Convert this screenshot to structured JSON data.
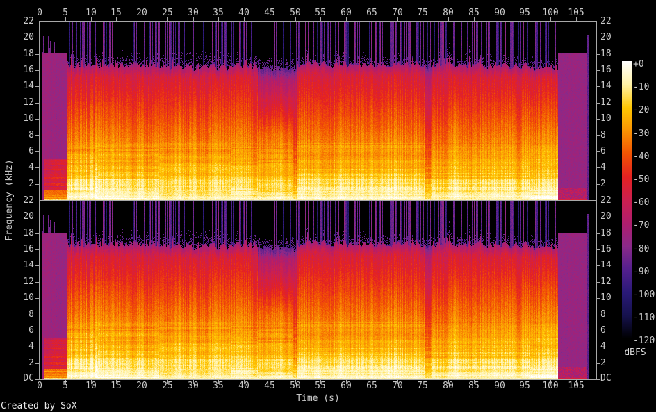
{
  "footer": {
    "credit": "Created by SoX"
  },
  "axes": {
    "time_label": "Time (s)",
    "freq_label": "Frequency (kHz)",
    "time_ticks": [
      0,
      5,
      10,
      15,
      20,
      25,
      30,
      35,
      40,
      45,
      50,
      55,
      60,
      65,
      70,
      75,
      80,
      85,
      90,
      95,
      100,
      105
    ],
    "freq_ticks_khz": [
      22,
      20,
      18,
      16,
      14,
      12,
      10,
      8,
      6,
      4,
      2
    ],
    "dc_label": "DC"
  },
  "colorbar": {
    "unit": "dBFS",
    "labels": [
      "+0",
      "-10",
      "-20",
      "-30",
      "-40",
      "-50",
      "-60",
      "-70",
      "-80",
      "-90",
      "-100",
      "-110",
      "-120"
    ]
  },
  "chart_data": {
    "type": "heatmap",
    "subtype": "stereo-audio-spectrogram",
    "channels": 2,
    "time_range_s": [
      0,
      109
    ],
    "freq_range_khz": [
      0,
      22
    ],
    "dbfs_range": [
      0,
      -120
    ],
    "time_tick_step_s": 5,
    "freq_tick_step_khz": 2,
    "palette": [
      {
        "db": -120,
        "color": "#000000"
      },
      {
        "db": -110,
        "color": "#16124e"
      },
      {
        "db": -100,
        "color": "#2a1a78"
      },
      {
        "db": -90,
        "color": "#55208e"
      },
      {
        "db": -80,
        "color": "#8b2a8a"
      },
      {
        "db": -70,
        "color": "#b01e6e"
      },
      {
        "db": -60,
        "color": "#cc2050"
      },
      {
        "db": -50,
        "color": "#e52222"
      },
      {
        "db": -40,
        "color": "#f25404"
      },
      {
        "db": -30,
        "color": "#fa9303"
      },
      {
        "db": -20,
        "color": "#ffc804"
      },
      {
        "db": -10,
        "color": "#fff2a6"
      },
      {
        "db": 0,
        "color": "#ffffff"
      }
    ],
    "segments": [
      {
        "t0": 0.0,
        "t1": 0.4,
        "type": "silence"
      },
      {
        "t0": 0.4,
        "t1": 5.3,
        "type": "quiet_block",
        "top_khz": 18.0,
        "level_db": -76,
        "low_boost": true,
        "hf_ticks": true
      },
      {
        "t0": 5.3,
        "t1": 10.7,
        "type": "music",
        "cutoff_khz": 16.6,
        "floor_db": -13,
        "slope_db_per_khz": 3.0,
        "stripe_db": 6,
        "transient_density": 0.38
      },
      {
        "t0": 10.7,
        "t1": 11.3,
        "type": "music",
        "cutoff_khz": 16.6,
        "floor_db": -9,
        "slope_db_per_khz": 3.0,
        "stripe_db": 6,
        "transient_density": 0.5
      },
      {
        "t0": 11.3,
        "t1": 23.3,
        "type": "music",
        "cutoff_khz": 16.6,
        "floor_db": -12,
        "slope_db_per_khz": 2.95,
        "stripe_db": 4,
        "transient_density": 0.3
      },
      {
        "t0": 23.3,
        "t1": 37.4,
        "type": "music",
        "cutoff_khz": 16.3,
        "floor_db": -12,
        "slope_db_per_khz": 2.95,
        "stripe_db": 4,
        "transient_density": 0.3,
        "fuzz_top_khz": 18.6
      },
      {
        "t0": 37.4,
        "t1": 42.6,
        "type": "music",
        "cutoff_khz": 16.5,
        "floor_db": -12,
        "slope_db_per_khz": 2.9,
        "stripe_db": 4,
        "transient_density": 0.3
      },
      {
        "t0": 42.6,
        "t1": 49.6,
        "type": "music_soft_highs",
        "cutoff_khz": 16.2,
        "floor_db": -14,
        "slope_db_per_khz": 2.6,
        "hi_level_db": -73,
        "stripe_db": 3,
        "transient_density": 0.12
      },
      {
        "t0": 49.6,
        "t1": 50.4,
        "type": "music",
        "cutoff_khz": 16.0,
        "floor_db": -21,
        "slope_db_per_khz": 3.1,
        "stripe_db": 3,
        "transient_density": 0.15
      },
      {
        "t0": 50.4,
        "t1": 75.5,
        "type": "music",
        "cutoff_khz": 16.7,
        "floor_db": -11,
        "slope_db_per_khz": 2.9,
        "stripe_db": 4,
        "transient_density": 0.33
      },
      {
        "t0": 75.5,
        "t1": 76.6,
        "type": "music",
        "cutoff_khz": 16.3,
        "floor_db": -19,
        "slope_db_per_khz": 3.2,
        "stripe_db": 3,
        "transient_density": 0.2
      },
      {
        "t0": 76.6,
        "t1": 96.0,
        "type": "music",
        "cutoff_khz": 16.5,
        "floor_db": -12,
        "slope_db_per_khz": 2.9,
        "stripe_db": 4,
        "transient_density": 0.3
      },
      {
        "t0": 96.0,
        "t1": 101.4,
        "type": "music",
        "cutoff_khz": 16.2,
        "floor_db": -12,
        "slope_db_per_khz": 2.95,
        "stripe_db": 4,
        "transient_density": 0.35,
        "bright_edge": true
      },
      {
        "t0": 101.4,
        "t1": 107.2,
        "type": "quiet_block",
        "top_khz": 18.0,
        "level_db": -77,
        "low_boost": false
      },
      {
        "t0": 107.2,
        "t1": 107.4,
        "type": "spike",
        "top_khz": 20.3,
        "level_db": -88
      },
      {
        "t0": 107.4,
        "t1": 109.0,
        "type": "silence"
      }
    ]
  }
}
